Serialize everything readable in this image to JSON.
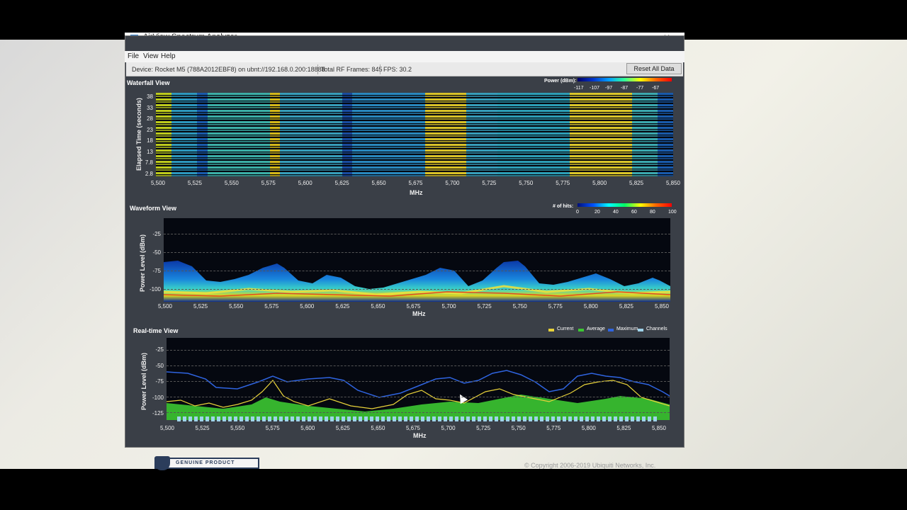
{
  "window": {
    "title": "AirView Spectrum Analyzer"
  },
  "menu": [
    "File",
    "View",
    "Help"
  ],
  "status": {
    "device": "Device: Rocket M5 (788A2012EBF8) on ubnt://192.168.0.200:18888",
    "frames": "Total RF Frames: 845",
    "fps": "FPS: 30.2",
    "reset": "Reset All Data"
  },
  "waterfall": {
    "title": "Waterfall View",
    "ylabel": "Elapsed Time (seconds)",
    "yticks": [
      "38",
      "33",
      "28",
      "23",
      "18",
      "13",
      "7.8",
      "2.8"
    ],
    "legend_title": "Power (dBm):",
    "legend_ticks": [
      "-117",
      "-107",
      "-97",
      "-87",
      "-77",
      "-67"
    ]
  },
  "waveform": {
    "title": "Waveform View",
    "ylabel": "Power Level (dBm)",
    "yticks": [
      "-25",
      "-50",
      "-75",
      "-100"
    ],
    "legend_title": "# of hits:",
    "legend_ticks": [
      "0",
      "20",
      "40",
      "60",
      "80",
      "100"
    ]
  },
  "realtime": {
    "title": "Real-time View",
    "ylabel": "Power Level (dBm)",
    "yticks": [
      "-25",
      "-50",
      "-75",
      "-100",
      "-125"
    ],
    "legend": [
      {
        "label": "Current",
        "color": "#e8d23a"
      },
      {
        "label": "Average",
        "color": "#3cc832"
      },
      {
        "label": "Maximum",
        "color": "#2f64e0"
      },
      {
        "label": "Channels",
        "color": "#9fd3ea"
      }
    ]
  },
  "xaxis": {
    "label": "MHz",
    "ticks": [
      "5,500",
      "5,525",
      "5,550",
      "5,575",
      "5,600",
      "5,625",
      "5,650",
      "5,675",
      "5,700",
      "5,725",
      "5,750",
      "5,775",
      "5,800",
      "5,825",
      "5,850"
    ]
  },
  "footer": {
    "copyright": "© Copyright 2006-2019 Ubiquiti Networks, Inc.",
    "badge": "GENUINE PRODUCT"
  },
  "colors": {
    "window_bg": "#3a3f47",
    "plot_bg": "#050810",
    "accent_blue": "#1e73c8"
  }
}
